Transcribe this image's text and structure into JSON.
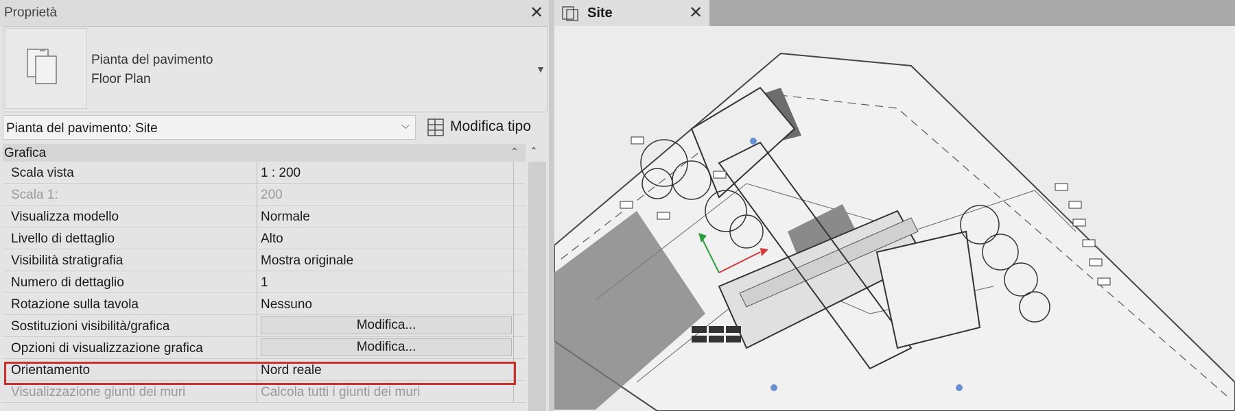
{
  "properties": {
    "title": "Proprietà",
    "close": "✕",
    "type_name_it": "Pianta del pavimento",
    "type_name_en": "Floor Plan",
    "selector_value": "Pianta del pavimento: Site",
    "edit_type_label": "Modifica tipo",
    "section": "Grafica",
    "rows": [
      {
        "key": "Scala vista",
        "value": "1 : 200"
      },
      {
        "key": "Scala  1:",
        "value": "200"
      },
      {
        "key": "Visualizza modello",
        "value": "Normale"
      },
      {
        "key": "Livello di dettaglio",
        "value": "Alto"
      },
      {
        "key": "Visibilità stratigrafia",
        "value": "Mostra originale"
      },
      {
        "key": "Numero di dettaglio",
        "value": "1"
      },
      {
        "key": "Rotazione sulla tavola",
        "value": "Nessuno"
      },
      {
        "key": "Sostituzioni visibilità/grafica",
        "value": "Modifica..."
      },
      {
        "key": "Opzioni di visualizzazione grafica",
        "value": "Modifica..."
      },
      {
        "key": "Orientamento",
        "value": "Nord reale"
      },
      {
        "key": "Visualizzazione giunti dei muri",
        "value": "Calcola tutti i giunti dei muri"
      }
    ]
  },
  "view_tab": {
    "title": "Site",
    "close": "✕"
  },
  "colors": {
    "highlight": "#c9302c",
    "accent_green": "#2e9e3a",
    "accent_red": "#d43a3a"
  }
}
